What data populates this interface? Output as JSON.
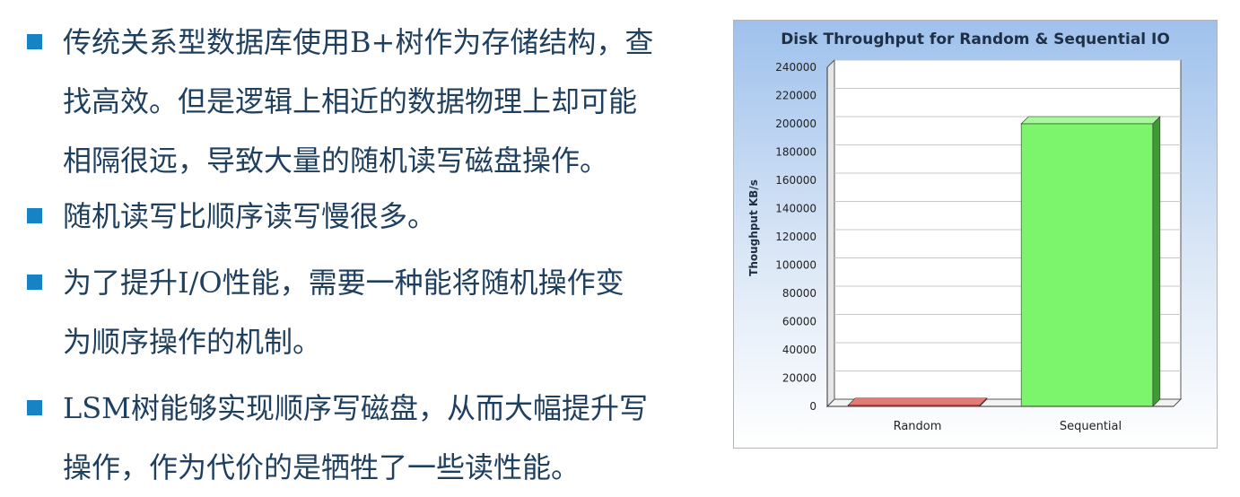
{
  "bullets": [
    {
      "text": "传统关系型数据库使用B+树作为存储结构，查找高效。但是逻辑上相近的数据物理上却可能相隔很远，导致大量的随机读写磁盘操作。",
      "lines": [
        "传统关系型数据库使用B+树作为存储结构，查",
        "找高效。但是逻辑上相近的数据物理上却可能",
        "相隔很远，导致大量的随机读写磁盘操作。"
      ]
    },
    {
      "text": "随机读写比顺序读写慢很多。",
      "lines": [
        "随机读写比顺序读写慢很多。"
      ]
    },
    {
      "text": "为了提升I/O性能，需要一种能将随机操作变为顺序操作的机制。",
      "lines": [
        "为了提升I/O性能，需要一种能将随机操作变",
        "为顺序操作的机制。"
      ]
    },
    {
      "text": "LSM树能够实现顺序写磁盘，从而大幅提升写操作，作为代价的是牺牲了一些读性能。",
      "lines": [
        "LSM树能够实现顺序写磁盘，从而大幅提升写",
        "操作，作为代价的是牺牲了一些读性能。"
      ]
    }
  ],
  "chart_data": {
    "type": "bar",
    "title": "Disk Throughput for Random & Sequential IO",
    "xlabel": "",
    "ylabel": "Thoughput KB/s",
    "categories": [
      "Random",
      "Sequential"
    ],
    "values": [
      800,
      200000
    ],
    "ylim": [
      0,
      240000
    ],
    "yticks": [
      "0",
      "20000",
      "40000",
      "60000",
      "80000",
      "100000",
      "120000",
      "140000",
      "160000",
      "180000",
      "200000",
      "220000",
      "240000"
    ],
    "colors": [
      "#d9534f",
      "#7cf46c"
    ],
    "grid": true,
    "legend": "none"
  }
}
